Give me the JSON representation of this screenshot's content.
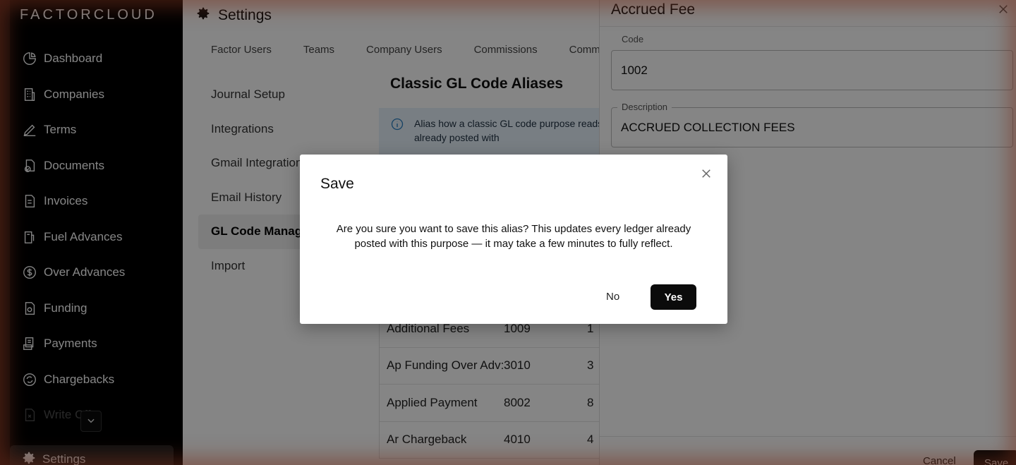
{
  "sidebar": {
    "brand": "FACTORCLOUD",
    "items": [
      {
        "label": "Dashboard",
        "icon": "pie-chart-icon"
      },
      {
        "label": "Companies",
        "icon": "building-icon"
      },
      {
        "label": "Terms",
        "icon": "pen-icon"
      },
      {
        "label": "Documents",
        "icon": "document-check-icon"
      },
      {
        "label": "Invoices",
        "icon": "invoice-icon"
      },
      {
        "label": "Fuel Advances",
        "icon": "fuel-icon"
      },
      {
        "label": "Over Advances",
        "icon": "dollar-circle-icon"
      },
      {
        "label": "Funding",
        "icon": "funding-icon"
      },
      {
        "label": "Payments",
        "icon": "payments-icon"
      },
      {
        "label": "Chargebacks",
        "icon": "refresh-circle-icon"
      },
      {
        "label": "Write Offs",
        "icon": "write-off-icon"
      }
    ],
    "settings_label": "Settings",
    "collapse_icon": "chevron-down-icon"
  },
  "header": {
    "title": "Settings",
    "tabs": [
      "Factor Users",
      "Teams",
      "Company Users",
      "Commissions",
      "Comm"
    ]
  },
  "subnav": {
    "items": [
      "Journal Setup",
      "Integrations",
      "Gmail Integration",
      "Email History",
      "GL Code Manag",
      "Import"
    ]
  },
  "content": {
    "title": "Classic GL Code Aliases",
    "info_text": "Alias how a classic GL code purpose reads. This updates every ledger already posted with",
    "rows": [
      {
        "name": "Additional Fees",
        "code": "1009",
        "alias": "1"
      },
      {
        "name": "Ap Funding Over Adv:",
        "code": "3010",
        "alias": "3"
      },
      {
        "name": "Applied Payment",
        "code": "8002",
        "alias": "8"
      },
      {
        "name": "Ar Chargeback",
        "code": "4010",
        "alias": "4"
      }
    ]
  },
  "drawer": {
    "title": "Accrued Fee",
    "code_label": "Code",
    "code_value": "1002",
    "description_label": "Description",
    "description_value": "ACCRUED COLLECTION FEES",
    "cancel_label": "Cancel",
    "save_label": "Save"
  },
  "dialog": {
    "title": "Save",
    "message": "Are you sure you want to save this alias? This updates every ledger already posted with this purpose — it may take a few minutes to fully reflect.",
    "no_label": "No",
    "yes_label": "Yes"
  }
}
